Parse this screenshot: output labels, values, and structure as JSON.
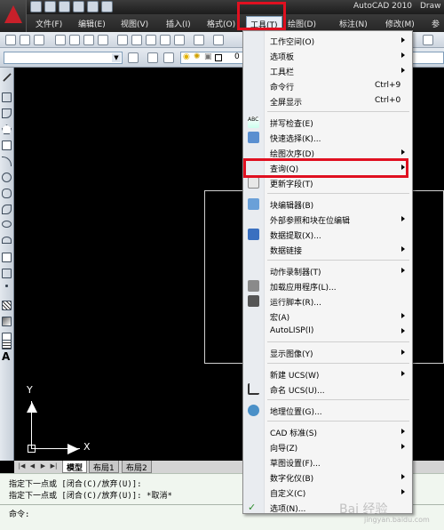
{
  "window": {
    "app_title": "AutoCAD 2010",
    "doc_title": "Draw"
  },
  "menubar": {
    "items": [
      "文件(F)",
      "编辑(E)",
      "视图(V)",
      "插入(I)",
      "格式(O)",
      "工具(T)",
      "绘图(D)",
      "标注(N)",
      "修改(M)",
      "参"
    ]
  },
  "toolbar2": {
    "layer_value": "0"
  },
  "tools_menu": {
    "items": [
      {
        "label": "工作空间(O)",
        "submenu": true
      },
      {
        "label": "选项板",
        "submenu": true
      },
      {
        "label": "工具栏",
        "submenu": true
      },
      {
        "label": "命令行",
        "shortcut": "Ctrl+9"
      },
      {
        "label": "全屏显示",
        "shortcut": "Ctrl+0"
      },
      {
        "label": "拼写检查(E)",
        "icon": "spell-check-icon"
      },
      {
        "label": "快速选择(K)...",
        "icon": "quick-select-icon"
      },
      {
        "label": "绘图次序(D)",
        "submenu": true
      },
      {
        "label": "查询(Q)",
        "submenu": true
      },
      {
        "label": "更新字段(T)",
        "icon": "update-field-icon"
      },
      {
        "label": "块编辑器(B)",
        "icon": "block-editor-icon"
      },
      {
        "label": "外部参照和块在位编辑",
        "submenu": true
      },
      {
        "label": "数据提取(X)...",
        "icon": "data-extraction-icon"
      },
      {
        "label": "数据链接",
        "submenu": true
      },
      {
        "label": "动作录制器(T)",
        "submenu": true
      },
      {
        "label": "加载应用程序(L)...",
        "icon": "load-app-icon"
      },
      {
        "label": "运行脚本(R)...",
        "icon": "run-script-icon"
      },
      {
        "label": "宏(A)",
        "submenu": true
      },
      {
        "label": "AutoLISP(I)",
        "submenu": true
      },
      {
        "label": "显示图像(Y)",
        "submenu": true
      },
      {
        "label": "新建 UCS(W)",
        "submenu": true
      },
      {
        "label": "命名 UCS(U)...",
        "icon": "named-ucs-icon"
      },
      {
        "label": "地理位置(G)...",
        "icon": "geographic-location-icon"
      },
      {
        "label": "CAD 标准(S)",
        "submenu": true
      },
      {
        "label": "向导(Z)",
        "submenu": true
      },
      {
        "label": "草图设置(F)..."
      },
      {
        "label": "数字化仪(B)",
        "submenu": true
      },
      {
        "label": "自定义(C)",
        "submenu": true
      },
      {
        "label": "选项(N)...",
        "icon": "options-check-icon"
      }
    ]
  },
  "drawing": {
    "ucs_y_label": "Y",
    "ucs_x_label": "X"
  },
  "layout_tabs": {
    "model": "模型",
    "layout1": "布局1",
    "layout2": "布局2"
  },
  "command": {
    "line1": "指定下一点或 [闭合(C)/放弃(U)]:",
    "line2": "指定下一点或 [闭合(C)/放弃(U)]: *取消*",
    "prompt": "命令:"
  },
  "watermark": {
    "text": "Bai 经验",
    "url": "jingyan.baidu.com"
  },
  "colors": {
    "highlight_box": "#e01020",
    "canvas": "#000000",
    "command_bg": "#f0f6ef"
  }
}
